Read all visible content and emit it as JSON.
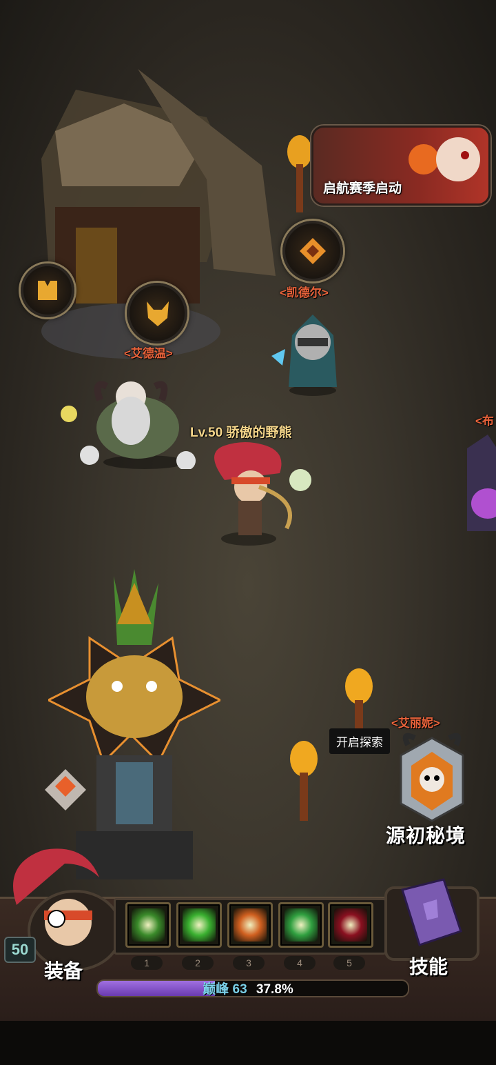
{
  "event_banner": {
    "label": "启航赛季启动"
  },
  "npcs": {
    "kaideer": "<凯德尔>",
    "aidewen": "<艾德温>",
    "aiyuni": "<艾丽妮>",
    "bu": "<布"
  },
  "player": {
    "name": "Lv.50 骄傲的野熊",
    "level": "50"
  },
  "dungeon": {
    "tooltip": "开启探索",
    "label": "源初秘境"
  },
  "skills": [
    {
      "num": "1",
      "color": "#3a8a2a",
      "icon": "arrow-skill-icon"
    },
    {
      "num": "2",
      "color": "#3ab030",
      "icon": "slash-skill-icon"
    },
    {
      "num": "3",
      "color": "#d06020",
      "icon": "vortex-skill-icon"
    },
    {
      "num": "4",
      "color": "#30a040",
      "icon": "tornado-skill-icon"
    },
    {
      "num": "5",
      "color": "#8a1020",
      "icon": "demon-skill-icon"
    }
  ],
  "buttons": {
    "equip": "装备",
    "skills": "技能"
  },
  "xp": {
    "rank_label": "巅峰",
    "rank_value": "63",
    "percent": "37.8%",
    "fraction": 0.378
  }
}
